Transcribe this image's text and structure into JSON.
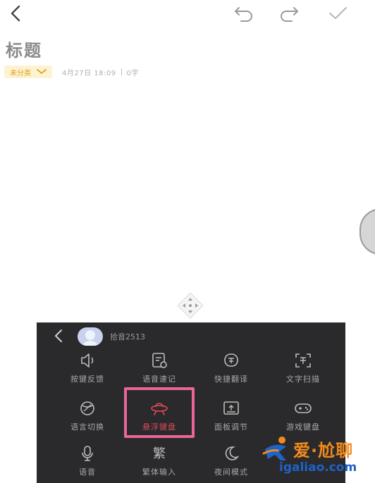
{
  "topbar": {
    "back_icon": "chevron-left-icon",
    "undo_icon": "undo-icon",
    "redo_icon": "redo-icon",
    "done_icon": "checkmark-icon"
  },
  "note": {
    "title": "标题",
    "category": "未分类",
    "date": "4月27日 18:09",
    "word_count": "0字"
  },
  "keyboard": {
    "account_name": "拾音2513",
    "tools": [
      {
        "label": "按键反馈",
        "icon": "speaker-icon"
      },
      {
        "label": "语音速记",
        "icon": "voice-note-icon"
      },
      {
        "label": "快捷翻译",
        "icon": "translate-icon"
      },
      {
        "label": "文字扫描",
        "icon": "text-scan-icon"
      },
      {
        "label": "语言切换",
        "icon": "language-switch-icon"
      },
      {
        "label": "悬浮键盘",
        "icon": "floating-keyboard-icon"
      },
      {
        "label": "面板调节",
        "icon": "panel-adjust-icon"
      },
      {
        "label": "游戏键盘",
        "icon": "gamepad-icon"
      },
      {
        "label": "语音",
        "icon": "microphone-icon"
      },
      {
        "label": "繁体输入",
        "icon": "traditional-chinese-icon",
        "glyph": "繁"
      },
      {
        "label": "夜间模式",
        "icon": "moon-icon"
      }
    ],
    "active_tool": "悬浮键盘",
    "highlight_color": "#e9659a",
    "active_color": "#e04a5a"
  },
  "watermark": {
    "text": "爱·尬聊",
    "url": "igaliao.com"
  }
}
